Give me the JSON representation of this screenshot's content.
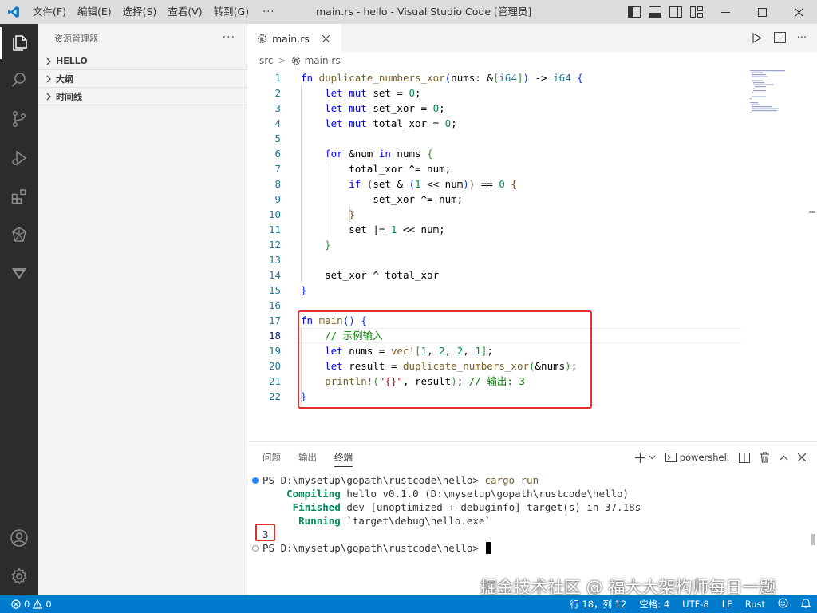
{
  "titlebar": {
    "menus": [
      "文件(F)",
      "编辑(E)",
      "选择(S)",
      "查看(V)",
      "转到(G)"
    ],
    "more": "···",
    "window_title": "main.rs - hello - Visual Studio Code [管理员]"
  },
  "sidebar": {
    "title": "资源管理器",
    "more": "···",
    "sections": [
      "HELLO",
      "大纲",
      "时间线"
    ]
  },
  "editor": {
    "tab_label": "main.rs",
    "breadcrumb": {
      "folder": "src",
      "file": "main.rs"
    },
    "line_numbers": [
      "1",
      "2",
      "3",
      "4",
      "5",
      "6",
      "7",
      "8",
      "9",
      "10",
      "11",
      "12",
      "13",
      "14",
      "15",
      "16",
      "17",
      "18",
      "19",
      "20",
      "21",
      "22"
    ]
  },
  "code": {
    "l1": {
      "kw": "fn",
      "name": "duplicate_numbers_xor",
      "p_open": "(",
      "param": "nums: &",
      "b_open": "[",
      "ty": "i64",
      "b_close": "]",
      "p_close": ")",
      "arrow": " -> ",
      "ret": "i64",
      "brace": "{"
    },
    "l2": {
      "a": "let",
      "b": "mut",
      "c": " set = ",
      "d": "0",
      "e": ";"
    },
    "l3": {
      "a": "let",
      "b": "mut",
      "c": " set_xor = ",
      "d": "0",
      "e": ";"
    },
    "l4": {
      "a": "let",
      "b": "mut",
      "c": " total_xor = ",
      "d": "0",
      "e": ";"
    },
    "l6": {
      "a": "for",
      "b": " &num ",
      "c": "in",
      "d": " nums ",
      "e": "{"
    },
    "l7": {
      "a": "total_xor ^= num;"
    },
    "l8": {
      "a": "if",
      "b": " ",
      "c": "(",
      "d": "set & ",
      "e": "(",
      "f": "1",
      "g": " << num",
      "h": ")",
      "i": ")",
      "j": " == ",
      "k": "0",
      "l": " ",
      "m": "{"
    },
    "l9": {
      "a": "set_xor ^= num;"
    },
    "l10": {
      "a": "}"
    },
    "l11": {
      "a": "set |= ",
      "b": "1",
      "c": " << num;"
    },
    "l12": {
      "a": "}"
    },
    "l14": {
      "a": "set_xor ^ total_xor"
    },
    "l15": {
      "a": "}"
    },
    "l17": {
      "kw": "fn",
      "name": "main",
      "p": "()",
      "brace": "{"
    },
    "l18": {
      "a": "// 示例输入"
    },
    "l19": {
      "a": "let",
      "b": " nums = ",
      "c": "vec!",
      "d": "[",
      "e": "1",
      "f": ", ",
      "g": "2",
      "h": ", ",
      "i": "2",
      "j": ", ",
      "k": "1",
      "l": "]",
      "m": ";"
    },
    "l20": {
      "a": "let",
      "b": " result = ",
      "c": "duplicate_numbers_xor",
      "d": "(",
      "e": "&nums",
      "f": ")",
      "g": ";"
    },
    "l21": {
      "a": "println!",
      "b": "(",
      "c": "\"{}\"",
      "d": ", result",
      "e": ")",
      "f": "; ",
      "g": "// 输出: 3"
    },
    "l22": {
      "a": "}"
    }
  },
  "panel": {
    "tabs": [
      "问题",
      "输出",
      "终端"
    ],
    "shell": "powershell"
  },
  "terminal": {
    "prompt1": "PS D:\\mysetup\\gopath\\rustcode\\hello> ",
    "cmd1": "cargo run",
    "compiling_label": "Compiling",
    "compiling_text": " hello v0.1.0 (D:\\mysetup\\gopath\\rustcode\\hello)",
    "finished_label": "Finished",
    "finished_text": " dev [unoptimized + debuginfo] target(s) in 37.18s",
    "running_label": "Running",
    "running_text": " `target\\debug\\hello.exe`",
    "output": "3",
    "prompt2": "PS D:\\mysetup\\gopath\\rustcode\\hello> "
  },
  "watermark": "掘金技术社区 @ 福大大架构师每日一题",
  "statusbar": {
    "errors": "0",
    "warnings": "0",
    "position": "行 18，列 12",
    "spaces": "空格: 4",
    "encoding": "UTF-8",
    "eol": "LF",
    "language": "Rust"
  },
  "colors": {
    "accent": "#007acc",
    "highlight": "#e0302f"
  }
}
